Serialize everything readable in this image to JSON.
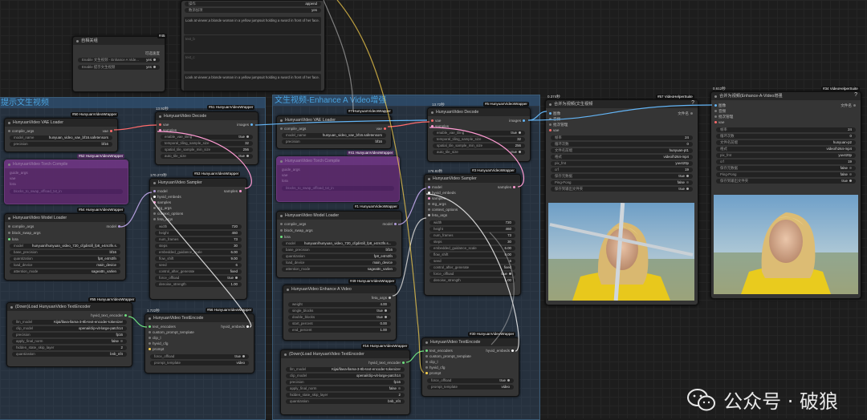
{
  "groups": {
    "left": "提示文生视频",
    "middle": "文生视频-Enhance A Video增强"
  },
  "node45": {
    "badge": "#45",
    "title": "自相关组",
    "right_label": "可选速度",
    "rows": [
      {
        "label": "Enable 文生视频 - Enhance A Vide...",
        "value": "yes"
      },
      {
        "label": "Enable 提示文生视频",
        "value": "yes"
      }
    ]
  },
  "prompt_node": {
    "rows": [
      {
        "label": "操作",
        "value": "append"
      },
      {
        "label": "数添加项",
        "value": "yes"
      }
    ],
    "text1": "Look at viewer,a blonde woman in a yellow jumpsuit holding a sword in front of her face.",
    "text2": "Look at viewer,a blonde woman in a yellow jumpsuit holding a sword in front of her face.",
    "placeholder1": "text_b",
    "placeholder2": "text_c"
  },
  "vae_left": {
    "badge": "#50 HunyuanVideoWrapper",
    "title": "HunyuanVideo VAE Loader",
    "input": "compile_args",
    "output": "vae",
    "widgets": [
      {
        "k": "model_name",
        "v": "hunyuan_video_vae_bf16.safetensors"
      },
      {
        "k": "precision",
        "v": "bf16"
      }
    ]
  },
  "purple_left": {
    "badge": "#52 HunyuanVideoWrapper",
    "title": "HunyuanVideo Torch Compile",
    "rows": [
      "guide_args",
      "vae",
      "lora",
      "blocks_to_swap_offload_txt_in"
    ]
  },
  "model_left": {
    "badge": "#54 HunyuanVideoWrapper",
    "title": "HunyuanVideo Model Loader",
    "inputs": [
      "compile_args",
      "block_swap_args",
      "lora"
    ],
    "output": "model",
    "widgets": [
      {
        "k": "model",
        "v": "hunyuan\\hunyuan_video_720_cfgdistill_fp8_e4m3fn.s..."
      },
      {
        "k": "base_precision",
        "v": "bf16"
      },
      {
        "k": "quantization",
        "v": "fp8_e4m3fn"
      },
      {
        "k": "load_device",
        "v": "main_device"
      },
      {
        "k": "attention_mode",
        "v": "sageattn_varlen"
      }
    ]
  },
  "decode_left": {
    "timer": "13.92秒",
    "badge": "#51 HunyuanVideoWrapper",
    "title": "HunyuanVideo Decode",
    "inputs": [
      "vae",
      "samples"
    ],
    "output": "images",
    "widgets": [
      {
        "k": "enable_vae_tiling",
        "v": "true"
      },
      {
        "k": "temporal_tiling_sample_size",
        "v": "32"
      },
      {
        "k": "spatial_tile_sample_min_size",
        "v": "256"
      },
      {
        "k": "auto_tile_size",
        "v": "true"
      }
    ]
  },
  "sampler_left": {
    "timer": "170.272秒",
    "badge": "#53 HunyuanVideoWrapper",
    "title": "HunyuanVideo Sampler",
    "inputs": [
      "model",
      "hyvid_embeds",
      "samples",
      "stg_args",
      "context_options",
      "feta_args"
    ],
    "output": "samples",
    "widgets": [
      {
        "k": "width",
        "v": "720"
      },
      {
        "k": "height",
        "v": "460"
      },
      {
        "k": "num_frames",
        "v": "73"
      },
      {
        "k": "steps",
        "v": "30"
      },
      {
        "k": "embedded_guidance_scale",
        "v": "6.00"
      },
      {
        "k": "flow_shift",
        "v": "9.00"
      },
      {
        "k": "seed",
        "v": "6"
      },
      {
        "k": "control_after_generate",
        "v": "fixed"
      },
      {
        "k": "force_offload",
        "v": "true"
      },
      {
        "k": "denoise_strength",
        "v": "1.00"
      }
    ]
  },
  "tenc_loader_left": {
    "badge": "#55 HunyuanVideoWrapper",
    "title": "(Down)Load HunyuanVideo TextEncoder",
    "output": "hyvid_text_encoder",
    "widgets": [
      {
        "k": "llm_model",
        "v": "Kijai/llava-llama-3-8b-text-encoder-tokenizer"
      },
      {
        "k": "clip_model",
        "v": "openai/clip-vit-large-patch14"
      },
      {
        "k": "precision",
        "v": "fp16"
      },
      {
        "k": "apply_final_norm",
        "v": "false"
      },
      {
        "k": "hidden_state_skip_layer",
        "v": "2"
      },
      {
        "k": "quantization",
        "v": "bnb_nf4"
      }
    ]
  },
  "tenc_left": {
    "timer": "1.722秒",
    "badge": "#56 HunyuanVideoWrapper",
    "title": "HunyuanVideo TextEncode",
    "inputs": [
      "text_encoders",
      "custom_prompt_template",
      "clip_l",
      "hyvid_cfg",
      "prompt"
    ],
    "output": "hyvid_embeds",
    "widgets": [
      {
        "k": "force_offload",
        "v": "true"
      },
      {
        "k": "prompt_template",
        "v": "video"
      }
    ]
  },
  "vae_mid": {
    "badge": "#7 HunyuanVideoWrapper",
    "title": "HunyuanVideo VAE Loader",
    "input": "compile_args",
    "output": "vae",
    "widgets": [
      {
        "k": "model_name",
        "v": "hunyuan_video_vae_bf16.safetensors"
      },
      {
        "k": "precision",
        "v": "bf16"
      }
    ]
  },
  "purple_mid": {
    "badge": "#41 HunyuanVideoWrapper",
    "title": "HunyuanVideo Torch Compile",
    "rows": [
      "guide_args",
      "vae",
      "lora",
      "blocks_to_swap_offload_txt_in"
    ]
  },
  "model_mid": {
    "badge": "#1 HunyuanVideoWrapper",
    "title": "HunyuanVideo Model Loader",
    "inputs": [
      "compile_args",
      "block_swap_args",
      "lora"
    ],
    "output": "model",
    "widgets": [
      {
        "k": "model",
        "v": "hunyuan\\hunyuan_video_720_cfgdistill_fp8_e4m3fn.s..."
      },
      {
        "k": "base_precision",
        "v": "bf16"
      },
      {
        "k": "quantization",
        "v": "fp8_e4m3fn"
      },
      {
        "k": "load_device",
        "v": "main_device"
      },
      {
        "k": "attention_mode",
        "v": "sageattn_varlen"
      }
    ]
  },
  "decode_mid": {
    "timer": "13.72秒",
    "badge": "#5 HunyuanVideoWrapper",
    "title": "HunyuanVideo Decode",
    "inputs": [
      "vae",
      "samples"
    ],
    "output": "images",
    "widgets": [
      {
        "k": "enable_vae_tiling",
        "v": "true"
      },
      {
        "k": "temporal_tiling_sample_size",
        "v": "32"
      },
      {
        "k": "spatial_tile_sample_min_size",
        "v": "256"
      },
      {
        "k": "auto_tile_size",
        "v": "true"
      }
    ]
  },
  "sampler_mid": {
    "timer": "176.82秒",
    "badge": "#3 HunyuanVideoWrapper",
    "title": "HunyuanVideo Sampler",
    "inputs": [
      "model",
      "hyvid_embeds",
      "samples",
      "stg_args",
      "context_options",
      "feta_args"
    ],
    "output": "samples",
    "widgets": [
      {
        "k": "width",
        "v": "720"
      },
      {
        "k": "height",
        "v": "460"
      },
      {
        "k": "num_frames",
        "v": "73"
      },
      {
        "k": "steps",
        "v": "30"
      },
      {
        "k": "embedded_guidance_scale",
        "v": "6.00"
      },
      {
        "k": "flow_shift",
        "v": "9.00"
      },
      {
        "k": "seed",
        "v": "6"
      },
      {
        "k": "control_after_generate",
        "v": "fixed"
      },
      {
        "k": "force_offload",
        "v": "true"
      },
      {
        "k": "denoise_strength",
        "v": "1.00"
      }
    ]
  },
  "enhance_mid": {
    "badge": "#49 HunyuanVideoWrapper",
    "title": "HunyuanVideo Enhance A Video",
    "output": "feta_args",
    "widgets": [
      {
        "k": "weight",
        "v": "4.00"
      },
      {
        "k": "single_blocks",
        "v": "true"
      },
      {
        "k": "double_blocks",
        "v": "true"
      },
      {
        "k": "start_percent",
        "v": "0.00"
      },
      {
        "k": "end_percent",
        "v": "1.00"
      }
    ]
  },
  "tenc_loader_mid": {
    "badge": "#16 HunyuanVideoWrapper",
    "title": "(Down)Load HunyuanVideo TextEncoder",
    "output": "hyvid_text_encoder",
    "widgets": [
      {
        "k": "llm_model",
        "v": "Kijai/llava-llama-3-8b-text-encoder-tokenizer"
      },
      {
        "k": "clip_model",
        "v": "openai/clip-vit-large-patch14"
      },
      {
        "k": "precision",
        "v": "fp16"
      },
      {
        "k": "apply_final_norm",
        "v": "false"
      },
      {
        "k": "hidden_state_skip_layer",
        "v": "2"
      },
      {
        "k": "quantization",
        "v": "bnb_nf4"
      }
    ]
  },
  "tenc_mid": {
    "badge": "#30 HunyuanVideoWrapper",
    "title": "HunyuanVideo TextEncode",
    "inputs": [
      "text_encoders",
      "custom_prompt_template",
      "clip_l",
      "hyvid_cfg",
      "prompt"
    ],
    "output": "hyvid_embeds",
    "widgets": [
      {
        "k": "force_offload",
        "v": "true"
      },
      {
        "k": "prompt_template",
        "v": "video"
      }
    ]
  },
  "combine1": {
    "timer": "0.374秒",
    "badge": "#57 VideoHelperSuite",
    "title": "合并为视频(文生视频",
    "help": "?",
    "inputs": [
      "图像",
      "音频",
      "批次管理",
      "vae"
    ],
    "output": "文件名",
    "widgets": [
      {
        "k": "帧率",
        "v": "24"
      },
      {
        "k": "循环次数",
        "v": "0"
      },
      {
        "k": "文件名前缀",
        "v": "hunyuan-pt1"
      },
      {
        "k": "格式",
        "v": "video/h264-mp4"
      },
      {
        "k": "pix_fmt",
        "v": "yuv420p"
      },
      {
        "k": "crf",
        "v": "19"
      },
      {
        "k": "保存元数据",
        "v": "true"
      },
      {
        "k": "Ping-Pong",
        "v": "false"
      },
      {
        "k": "保存到输出文件夹",
        "v": "true"
      }
    ]
  },
  "combine2": {
    "timer": "0.612秒",
    "badge": "#34 VideoHelperSuite",
    "title": "合并为视频(Enhance-A-Video增强",
    "help": "?",
    "inputs": [
      "图像",
      "音频",
      "批次管理",
      "vae"
    ],
    "output": "文件名",
    "widgets": [
      {
        "k": "帧率",
        "v": "24"
      },
      {
        "k": "循环次数",
        "v": "0"
      },
      {
        "k": "文件名前缀",
        "v": "hunyuan-p2"
      },
      {
        "k": "格式",
        "v": "video/h264-mp4"
      },
      {
        "k": "pix_fmt",
        "v": "yuv420p"
      },
      {
        "k": "crf",
        "v": "19"
      },
      {
        "k": "保存元数据",
        "v": "false"
      },
      {
        "k": "Ping-Pong",
        "v": "false"
      },
      {
        "k": "保存到输出文件夹",
        "v": "true"
      }
    ]
  },
  "watermark": {
    "text": "公众号 · 破狼"
  },
  "colors": {
    "vae": "#ff6b6b",
    "latent": "#ff9bd3",
    "model": "#b39ddb",
    "embeds": "#ffffff",
    "text": "#6fe07f",
    "image": "#64b5f6",
    "feta": "#c0c0c0"
  }
}
